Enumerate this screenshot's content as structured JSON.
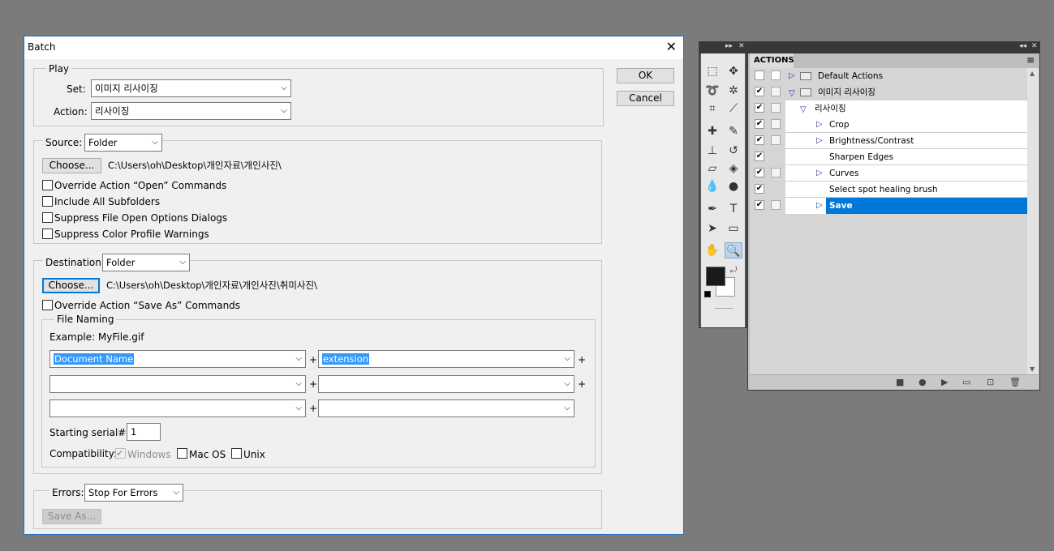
{
  "batch": {
    "title": "Batch",
    "close_glyph": "✕",
    "ok_label": "OK",
    "cancel_label": "Cancel",
    "play": {
      "legend": "Play",
      "set_label": "Set:",
      "set_value": "이미지 리사이징",
      "action_label": "Action:",
      "action_value": "리사이징"
    },
    "source": {
      "label": "Source:",
      "value": "Folder",
      "choose_label": "Choose...",
      "path": "C:\\Users\\oh\\Desktop\\개인자료\\개인사진\\",
      "options": [
        {
          "label": "Override Action “Open” Commands",
          "checked": false
        },
        {
          "label": "Include All Subfolders",
          "checked": false
        },
        {
          "label": "Suppress File Open Options Dialogs",
          "checked": false
        },
        {
          "label": "Suppress Color Profile Warnings",
          "checked": false
        }
      ]
    },
    "destination": {
      "label": "Destination:",
      "value": "Folder",
      "choose_label": "Choose...",
      "path": "C:\\Users\\oh\\Desktop\\개인자료\\개인사진\\취미사진\\",
      "override_label": "Override Action “Save As” Commands",
      "file_naming": {
        "legend": "File Naming",
        "example": "Example: MyFile.gif",
        "fields": [
          "Document Name",
          "extension",
          "",
          "",
          "",
          ""
        ],
        "plus": "+",
        "serial_label": "Starting serial#:",
        "serial_value": "1",
        "compat_label": "Compatibility:",
        "compat_windows": "Windows",
        "compat_mac": "Mac OS",
        "compat_unix": "Unix"
      }
    },
    "errors": {
      "label": "Errors:",
      "value": "Stop For Errors",
      "save_as_label": "Save As..."
    }
  },
  "tools_panel": {
    "collapse_glyph": "▸▸",
    "close_glyph": "✕",
    "foreground_color": "#1a1a1a",
    "background_color": "#ffffff"
  },
  "actions_panel": {
    "collapse_glyph": "◂◂",
    "close_glyph": "✕",
    "tab": "ACTIONS",
    "menu_glyph": "≡",
    "rows": [
      {
        "label": "Default Actions",
        "kind": "set"
      },
      {
        "label": "이미지 리사이징",
        "kind": "set"
      },
      {
        "label": "리사이징",
        "kind": "action"
      },
      {
        "label": "Crop",
        "kind": "step"
      },
      {
        "label": "Brightness/Contrast",
        "kind": "step"
      },
      {
        "label": "Sharpen Edges",
        "kind": "step"
      },
      {
        "label": "Curves",
        "kind": "step"
      },
      {
        "label": "Select spot healing brush",
        "kind": "step"
      },
      {
        "label": "Save",
        "kind": "step",
        "selected": true
      }
    ],
    "selection_color": "#0078d7"
  }
}
